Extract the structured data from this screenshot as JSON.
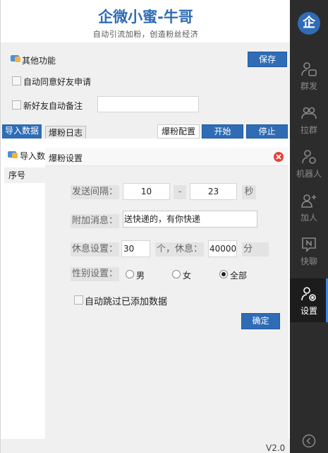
{
  "app": {
    "title": "企微小蜜-牛哥",
    "subtitle": "自动引流加粉，创造粉丝经济",
    "logo_char": "企",
    "version": "V2.0"
  },
  "other_functions": {
    "title": "其他功能",
    "save_label": "保存",
    "auto_accept_label": "自动同意好友申请",
    "auto_remark_label": "新好友自动备注",
    "auto_remark_value": ""
  },
  "tabs": [
    {
      "label": "导入数据"
    },
    {
      "label": "爆粉日志"
    }
  ],
  "toolbar": {
    "config_label": "爆粉配置",
    "start_label": "开始",
    "stop_label": "停止"
  },
  "data_pane": {
    "import_label": "导入数",
    "col_seq": "序号"
  },
  "dialog": {
    "title": "爆粉设置",
    "interval_label": "发送间隔：",
    "interval_min": "10",
    "interval_sep": "-",
    "interval_max": "23",
    "interval_unit": "秒",
    "message_label": "附加消息：",
    "message_value": "送快递的，有你快递",
    "rest_label": "休息设置：",
    "rest_every": "30",
    "rest_mid": "个，休息：",
    "rest_duration": "40000",
    "rest_unit": "分",
    "gender_label": "性别设置：",
    "gender_options": [
      "男",
      "女",
      "全部"
    ],
    "gender_selected": "全部",
    "skip_label": "自动跳过已添加数据",
    "confirm_label": "确定"
  },
  "sidebar": {
    "items": [
      {
        "label": "群发",
        "icon": "person-chat-icon"
      },
      {
        "label": "拉群",
        "icon": "group-icon"
      },
      {
        "label": "机器人",
        "icon": "robot-person-icon"
      },
      {
        "label": "加人",
        "icon": "add-person-icon"
      },
      {
        "label": "快聊",
        "icon": "quick-chat-icon"
      },
      {
        "label": "设置",
        "icon": "person-settings-icon"
      }
    ],
    "active": "设置"
  },
  "colors": {
    "accent": "#2f6cb5",
    "sidebar_bg": "#2c2c2c",
    "active_bar": "#3a86e0",
    "close_red": "#e0443a"
  }
}
